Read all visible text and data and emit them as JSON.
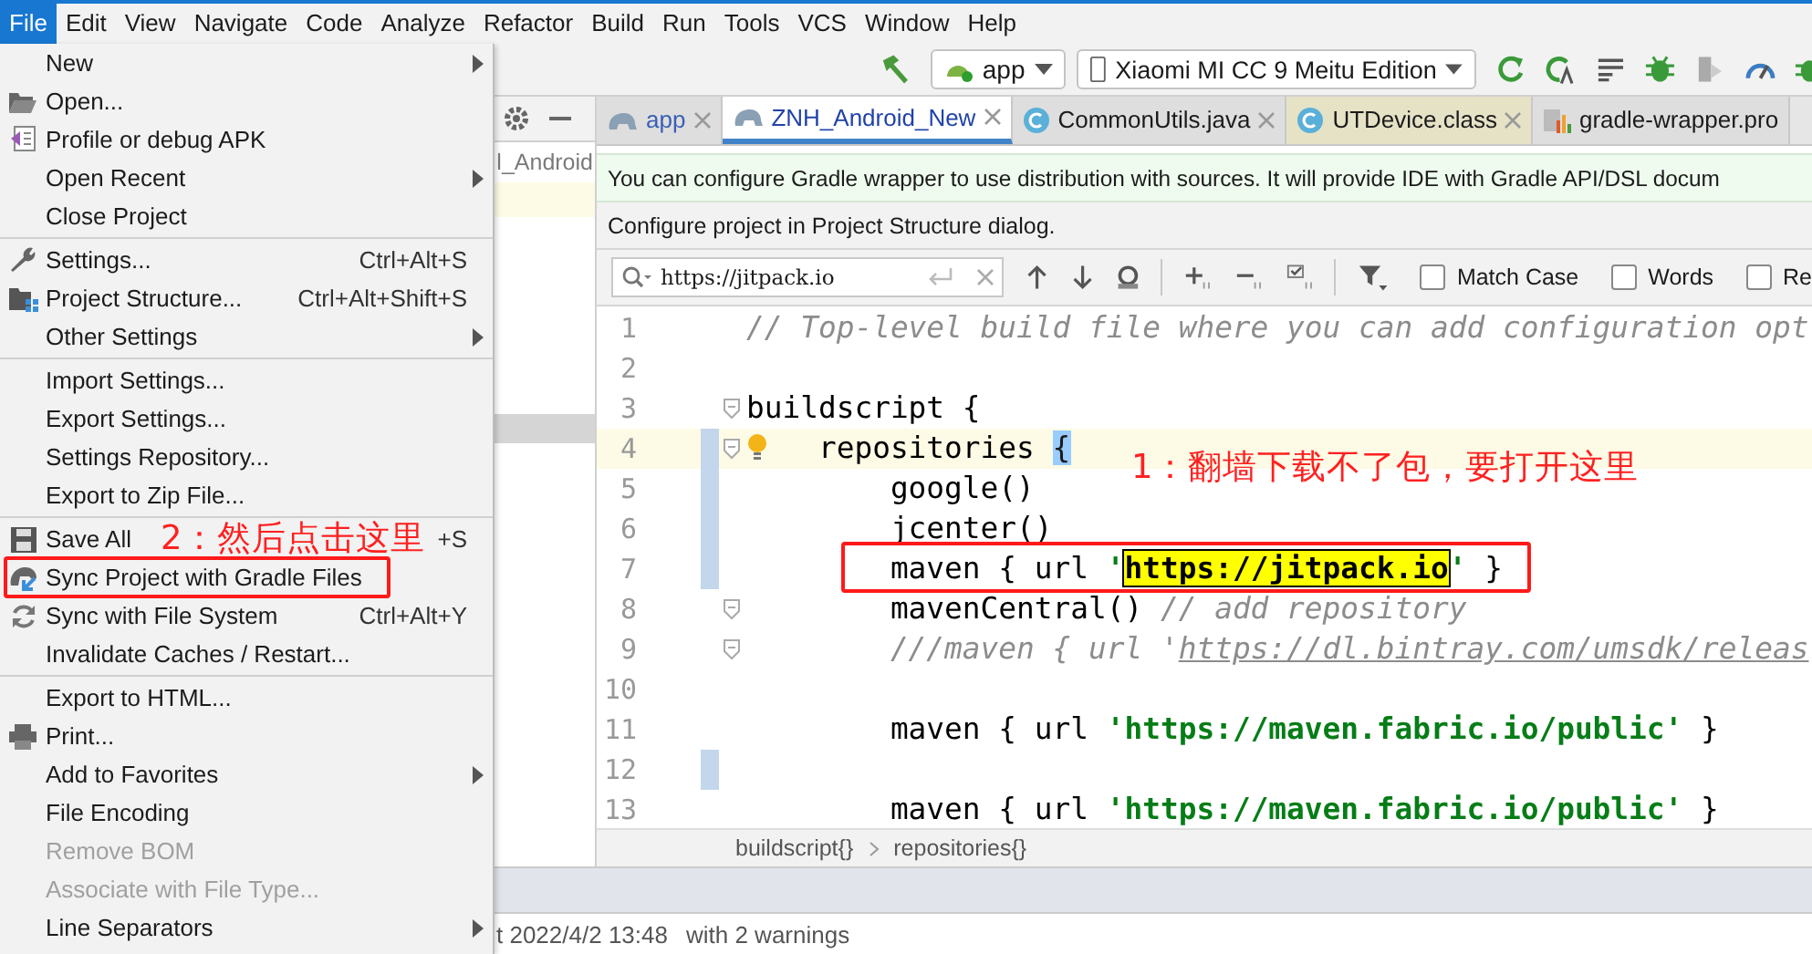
{
  "menubar": [
    {
      "label": "File",
      "selected": true
    },
    {
      "label": "Edit",
      "selected": false
    },
    {
      "label": "View",
      "selected": false
    },
    {
      "label": "Navigate",
      "selected": false
    },
    {
      "label": "Code",
      "selected": false
    },
    {
      "label": "Analyze",
      "selected": false
    },
    {
      "label": "Refactor",
      "selected": false
    },
    {
      "label": "Build",
      "selected": false
    },
    {
      "label": "Run",
      "selected": false
    },
    {
      "label": "Tools",
      "selected": false
    },
    {
      "label": "VCS",
      "selected": false
    },
    {
      "label": "Window",
      "selected": false
    },
    {
      "label": "Help",
      "selected": false
    }
  ],
  "toolbar": {
    "run_config": "app",
    "device": "Xiaomi MI CC 9 Meitu Edition"
  },
  "file_menu": [
    [
      {
        "label": "New",
        "submenu": true,
        "disabled": false
      },
      {
        "label": "Open...",
        "submenu": false,
        "disabled": false
      },
      {
        "label": "Profile or debug APK",
        "submenu": false,
        "disabled": false
      },
      {
        "label": "Open Recent",
        "submenu": true,
        "disabled": false
      },
      {
        "label": "Close Project",
        "submenu": false,
        "disabled": false
      }
    ],
    [
      {
        "label": "Settings...",
        "shortcut": "Ctrl+Alt+S",
        "submenu": false,
        "disabled": false
      },
      {
        "label": "Project Structure...",
        "shortcut": "Ctrl+Alt+Shift+S",
        "submenu": false,
        "disabled": false
      },
      {
        "label": "Other Settings",
        "submenu": true,
        "disabled": false
      }
    ],
    [
      {
        "label": "Import Settings...",
        "submenu": false,
        "disabled": false
      },
      {
        "label": "Export Settings...",
        "submenu": false,
        "disabled": false
      },
      {
        "label": "Settings Repository...",
        "submenu": false,
        "disabled": false
      },
      {
        "label": "Export to Zip File...",
        "submenu": false,
        "disabled": false
      }
    ],
    [
      {
        "label": "Save All",
        "shortcut": "+S",
        "submenu": false,
        "disabled": false
      },
      {
        "label": "Sync Project with Gradle Files",
        "submenu": false,
        "disabled": false
      },
      {
        "label": "Sync with File System",
        "shortcut": "Ctrl+Alt+Y",
        "submenu": false,
        "disabled": false
      },
      {
        "label": "Invalidate Caches / Restart...",
        "submenu": false,
        "disabled": false
      }
    ],
    [
      {
        "label": "Export to HTML...",
        "submenu": false,
        "disabled": false
      },
      {
        "label": "Print...",
        "submenu": false,
        "disabled": false
      },
      {
        "label": "Add to Favorites",
        "submenu": true,
        "disabled": false
      },
      {
        "label": "File Encoding",
        "submenu": false,
        "disabled": false
      },
      {
        "label": "Remove BOM",
        "submenu": false,
        "disabled": true
      },
      {
        "label": "Associate with File Type...",
        "submenu": false,
        "disabled": true
      },
      {
        "label": "Line Separators",
        "submenu": true,
        "disabled": false
      }
    ]
  ],
  "project_panel": {
    "text": "l_Android"
  },
  "tabs": [
    {
      "label": "app",
      "selected": false,
      "color": "#dedede"
    },
    {
      "label": "ZNH_Android_New",
      "selected": true,
      "color": "#ffffff"
    },
    {
      "label": "CommonUtils.java",
      "selected": false,
      "color": "#dedede"
    },
    {
      "label": "UTDevice.class",
      "selected": false,
      "color": "#e6e2c6"
    },
    {
      "label": "gradle-wrapper.pro",
      "selected": false,
      "color": "#dedede"
    }
  ],
  "banner": {
    "text": "You can configure Gradle wrapper to use distribution with sources. It will provide IDE with Gradle API/DSL docum"
  },
  "notice": {
    "text": "Configure project in Project Structure dialog."
  },
  "search": {
    "value": "https://jitpack.io",
    "options": [
      {
        "label": "Match Case",
        "checked": false
      },
      {
        "label": "Words",
        "checked": false
      },
      {
        "label": "Re",
        "checked": false
      }
    ]
  },
  "code_lines": [
    {
      "number": "1",
      "changed": false,
      "current": false,
      "fold": false,
      "segments": [
        {
          "kind": "comment",
          "text": "// Top-level build file where you can add configuration opt"
        }
      ]
    },
    {
      "number": "2",
      "changed": false,
      "current": false,
      "fold": false
    },
    {
      "number": "3",
      "changed": false,
      "current": false,
      "fold": true,
      "segments": [
        {
          "kind": "plain",
          "text": "buildscript {"
        }
      ]
    },
    {
      "number": "4",
      "changed": true,
      "current": true,
      "fold": true,
      "segments": [
        {
          "kind": "plain",
          "text": "    repositories "
        },
        {
          "kind": "brace",
          "text": "{"
        }
      ]
    },
    {
      "number": "5",
      "changed": true,
      "current": false,
      "fold": false,
      "segments": [
        {
          "kind": "plain",
          "text": "        google()"
        }
      ]
    },
    {
      "number": "6",
      "changed": true,
      "current": false,
      "fold": false,
      "segments": [
        {
          "kind": "plain",
          "text": "        jcenter()"
        }
      ]
    },
    {
      "number": "7",
      "changed": true,
      "current": false,
      "fold": false,
      "segments": [
        {
          "kind": "plain",
          "text": "        maven { url "
        },
        {
          "kind": "string",
          "text": "'"
        },
        {
          "kind": "match",
          "text": "https://jitpack.io"
        },
        {
          "kind": "string",
          "text": "'"
        },
        {
          "kind": "plain",
          "text": " }"
        }
      ]
    },
    {
      "number": "8",
      "changed": false,
      "current": false,
      "fold": true,
      "segments": [
        {
          "kind": "plain",
          "text": "        mavenCentral() "
        },
        {
          "kind": "comment",
          "text": "// add repository"
        }
      ]
    },
    {
      "number": "9",
      "changed": false,
      "current": false,
      "fold": true,
      "segments": [
        {
          "kind": "comment",
          "text": "        ///maven { url '"
        },
        {
          "kind": "link",
          "text": "https://dl.bintray.com/umsdk/releas"
        }
      ]
    },
    {
      "number": "10",
      "changed": false,
      "current": false,
      "fold": false
    },
    {
      "number": "11",
      "changed": false,
      "current": false,
      "fold": false,
      "segments": [
        {
          "kind": "plain",
          "text": "        maven { url "
        },
        {
          "kind": "string",
          "text": "'https://maven.fabric.io/public'"
        },
        {
          "kind": "plain",
          "text": " }"
        }
      ]
    },
    {
      "number": "12",
      "changed": true,
      "current": false,
      "fold": false
    },
    {
      "number": "13",
      "changed": false,
      "current": false,
      "fold": false,
      "segments": [
        {
          "kind": "plain",
          "text": "        maven { url "
        },
        {
          "kind": "string",
          "text": "'https://maven.fabric.io/public'"
        },
        {
          "kind": "plain",
          "text": " }"
        }
      ]
    }
  ],
  "breadcrumb": [
    "buildscript{}",
    "repositories{}"
  ],
  "status_bar": [
    "t 2022/4/2 13:48",
    "with 2 warnings"
  ],
  "annotations": [
    {
      "text": "1：翻墙下载不了包，要打开这里"
    },
    {
      "text": "2：然后点击这里"
    }
  ]
}
